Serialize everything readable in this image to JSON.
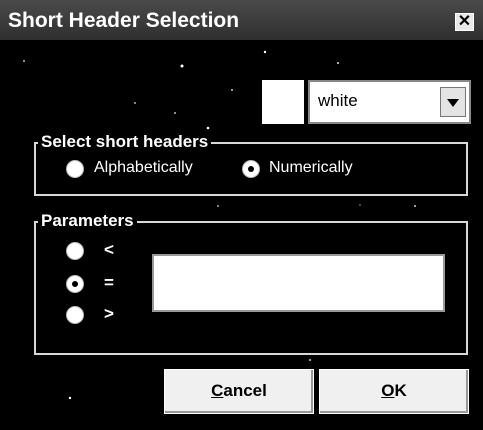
{
  "window": {
    "title": "Short Header Selection",
    "close_glyph": "✕"
  },
  "color_select": {
    "value": "white",
    "swatch_color": "#ffffff"
  },
  "select_group": {
    "label": "Select short headers",
    "options": [
      {
        "label": "Alphabetically",
        "selected": false
      },
      {
        "label": "Numerically",
        "selected": true
      }
    ]
  },
  "parameters": {
    "label": "Parameters",
    "operators": [
      {
        "symbol": "<",
        "selected": false
      },
      {
        "symbol": "=",
        "selected": true
      },
      {
        "symbol": ">",
        "selected": false
      }
    ],
    "value": ""
  },
  "buttons": {
    "cancel_first": "C",
    "cancel_rest": "ancel",
    "ok_first": "O",
    "ok_rest": "K"
  }
}
